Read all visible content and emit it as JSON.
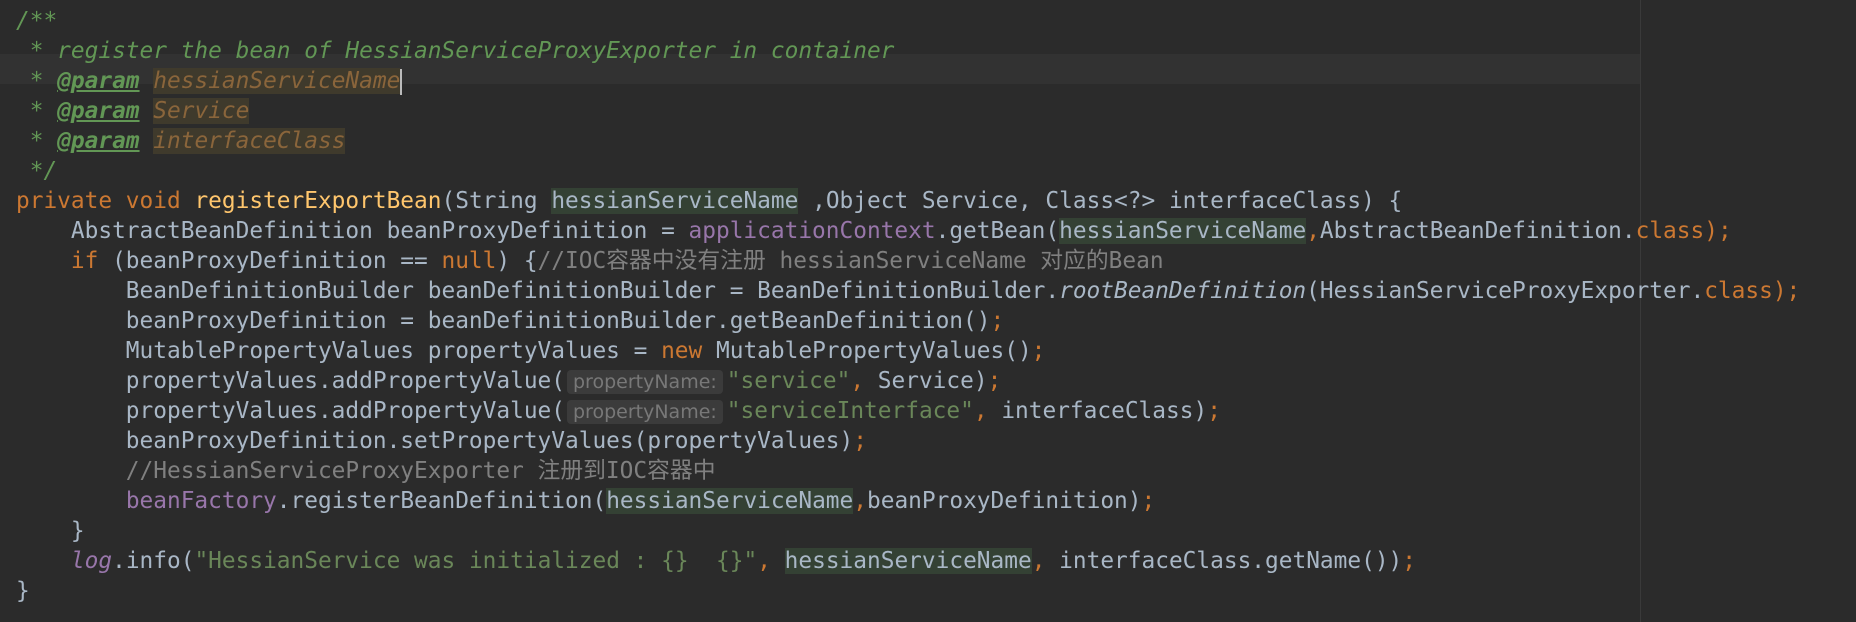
{
  "editor": {
    "lines": [
      [
        {
          "t": "/**",
          "c": "doc"
        }
      ],
      [
        {
          "t": " * register the bean of HessianServiceProxyExporter in container",
          "c": "doc"
        }
      ],
      [
        {
          "t": " * ",
          "c": "doc"
        },
        {
          "t": "@param",
          "c": "tag"
        },
        {
          "t": " ",
          "c": "doc"
        },
        {
          "t": "hessianServiceName",
          "c": "pname"
        },
        {
          "caret": true
        }
      ],
      [
        {
          "t": " * ",
          "c": "doc"
        },
        {
          "t": "@param",
          "c": "tag"
        },
        {
          "t": " ",
          "c": "doc"
        },
        {
          "t": "Service",
          "c": "pname"
        }
      ],
      [
        {
          "t": " * ",
          "c": "doc"
        },
        {
          "t": "@param",
          "c": "tag"
        },
        {
          "t": " ",
          "c": "doc"
        },
        {
          "t": "interfaceClass",
          "c": "pname"
        }
      ],
      [
        {
          "t": " */",
          "c": "doc"
        }
      ],
      [
        {
          "t": "private void ",
          "c": "kw"
        },
        {
          "t": "registerExportBean",
          "c": "fn"
        },
        {
          "t": "(String "
        },
        {
          "t": "hessianServiceName",
          "c": "hl"
        },
        {
          "t": " ,Object Service, Class<?> interfaceClass) {"
        }
      ],
      [
        {
          "t": "    AbstractBeanDefinition beanProxyDefinition = "
        },
        {
          "t": "applicationContext",
          "c": "field"
        },
        {
          "t": ".getBean("
        },
        {
          "t": "hessianServiceName",
          "c": "hl"
        },
        {
          "t": ",",
          "c": "kw"
        },
        {
          "t": "AbstractBeanDefinition."
        },
        {
          "t": "class",
          "c": "kw"
        },
        {
          "t": ");",
          "c": "kw"
        }
      ],
      [
        {
          "t": "    "
        },
        {
          "t": "if",
          "c": "kw"
        },
        {
          "t": " (beanProxyDefinition == "
        },
        {
          "t": "null",
          "c": "kw"
        },
        {
          "t": ") {"
        },
        {
          "t": "//IOC容器中没有注册 hessianServiceName 对应的Bean",
          "c": "cmt"
        }
      ],
      [
        {
          "t": "        BeanDefinitionBuilder beanDefinitionBuilder = BeanDefinitionBuilder."
        },
        {
          "t": "rootBeanDefinition",
          "c": "italic"
        },
        {
          "t": "(HessianServiceProxyExporter."
        },
        {
          "t": "class",
          "c": "kw"
        },
        {
          "t": ");",
          "c": "kw"
        }
      ],
      [
        {
          "t": "        beanProxyDefinition = beanDefinitionBuilder.getBeanDefinition()"
        },
        {
          "t": ";",
          "c": "kw"
        }
      ],
      [
        {
          "t": "        MutablePropertyValues propertyValues = "
        },
        {
          "t": "new",
          "c": "kw"
        },
        {
          "t": " MutablePropertyValues()"
        },
        {
          "t": ";",
          "c": "kw"
        }
      ],
      [
        {
          "t": "        propertyValues.addPropertyValue("
        },
        {
          "t": "propertyName:",
          "c": "hint"
        },
        {
          "t": "\"service\"",
          "c": "str"
        },
        {
          "t": ", ",
          "c": "kw"
        },
        {
          "t": "Service)"
        },
        {
          "t": ";",
          "c": "kw"
        }
      ],
      [
        {
          "t": "        propertyValues.addPropertyValue("
        },
        {
          "t": "propertyName:",
          "c": "hint"
        },
        {
          "t": "\"serviceInterface\"",
          "c": "str"
        },
        {
          "t": ", ",
          "c": "kw"
        },
        {
          "t": "interfaceClass)"
        },
        {
          "t": ";",
          "c": "kw"
        }
      ],
      [
        {
          "t": "        beanProxyDefinition.setPropertyValues(propertyValues)"
        },
        {
          "t": ";",
          "c": "kw"
        }
      ],
      [
        {
          "t": "        //HessianServiceProxyExporter 注册到IOC容器中",
          "c": "cmt"
        }
      ],
      [
        {
          "t": "        "
        },
        {
          "t": "beanFactory",
          "c": "field"
        },
        {
          "t": ".registerBeanDefinition("
        },
        {
          "t": "hessianServiceName",
          "c": "hl"
        },
        {
          "t": ",",
          "c": "kw"
        },
        {
          "t": "beanProxyDefinition)"
        },
        {
          "t": ";",
          "c": "kw"
        }
      ],
      [
        {
          "t": "    }"
        }
      ],
      [
        {
          "t": "    "
        },
        {
          "t": "log",
          "c": "field italic"
        },
        {
          "t": ".info("
        },
        {
          "t": "\"HessianService was initialized : {}  {}\"",
          "c": "str"
        },
        {
          "t": ", ",
          "c": "kw"
        },
        {
          "t": "hessianServiceName",
          "c": "hl"
        },
        {
          "t": ", ",
          "c": "kw"
        },
        {
          "t": "interfaceClass.getName())"
        },
        {
          "t": ";",
          "c": "kw"
        }
      ],
      [
        {
          "t": "}"
        }
      ]
    ]
  }
}
